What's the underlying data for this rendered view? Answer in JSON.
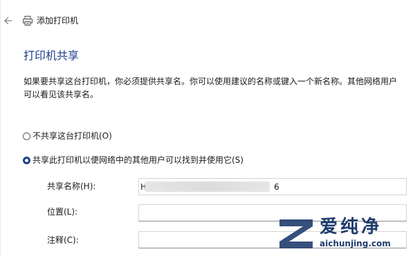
{
  "window": {
    "title": "添加打印机",
    "back_icon": "back-arrow-icon",
    "printer_icon": "printer-icon"
  },
  "section": {
    "heading": "打印机共享",
    "description": "如果要共享这台打印机，你必须提供共享名。你可以使用建议的名称或键入一个新名称。其他网络用户可以看见该共享名。"
  },
  "options": [
    {
      "label": "不共享这台打印机(O)",
      "selected": false
    },
    {
      "label": "共享此打印机以便网络中的其他用户可以找到并使用它(S)",
      "selected": true
    }
  ],
  "fields": {
    "share_name": {
      "label": "共享名称(H):",
      "value_prefix": "H",
      "value_suffix": "6"
    },
    "location": {
      "label": "位置(L):",
      "value": ""
    },
    "comment": {
      "label": "注释(C):",
      "value": ""
    }
  },
  "watermark": {
    "text_cn": "爱纯净",
    "url": "aichunjing.com",
    "color": "#1f3d6e"
  },
  "colors": {
    "accent": "#1c3f8c"
  }
}
